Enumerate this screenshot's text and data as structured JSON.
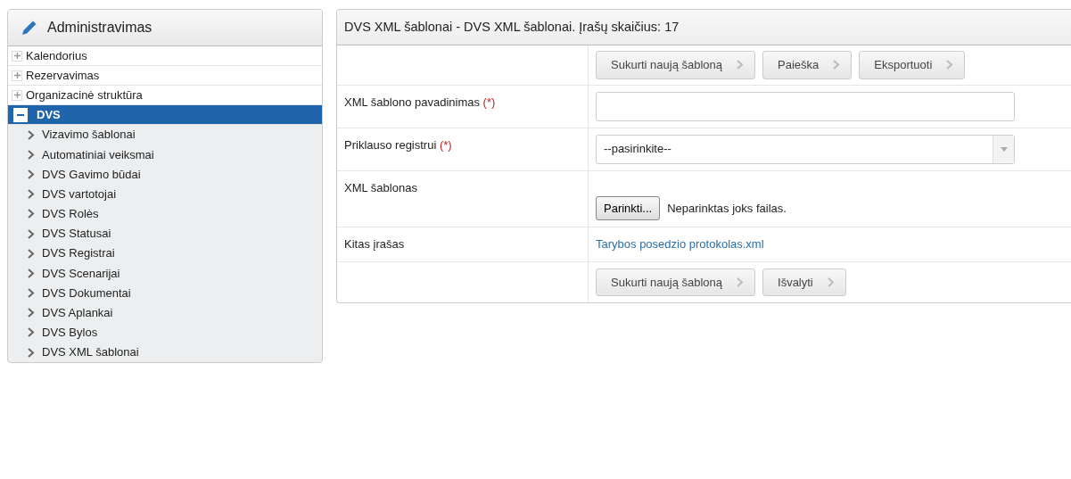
{
  "sidebar": {
    "title": "Administravimas",
    "items": [
      {
        "label": "Kalendorius",
        "expanded": false,
        "selected": false
      },
      {
        "label": "Rezervavimas",
        "expanded": false,
        "selected": false
      },
      {
        "label": "Organizacinė struktūra",
        "expanded": false,
        "selected": false
      },
      {
        "label": "DVS",
        "expanded": true,
        "selected": true,
        "children": [
          {
            "label": "Vizavimo šablonai"
          },
          {
            "label": "Automatiniai veiksmai"
          },
          {
            "label": "DVS Gavimo būdai"
          },
          {
            "label": "DVS vartotojai"
          },
          {
            "label": "DVS Rolės"
          },
          {
            "label": "DVS Statusai"
          },
          {
            "label": "DVS Registrai"
          },
          {
            "label": "DVS Scenarijai"
          },
          {
            "label": "DVS Dokumentai"
          },
          {
            "label": "DVS Aplankai"
          },
          {
            "label": "DVS Bylos"
          },
          {
            "label": "DVS XML šablonai"
          }
        ]
      }
    ]
  },
  "panel": {
    "title": "DVS XML šablonai - DVS XML šablonai. Įrašų skaičius: 17",
    "toolbar": [
      "Sukurti naują šabloną",
      "Paieška",
      "Eksportuoti"
    ],
    "rows": [
      {
        "kind": "text",
        "label": "XML šablono pavadinimas",
        "required": true,
        "required_mark": "(*)"
      },
      {
        "kind": "select",
        "label": "Priklauso registrui",
        "required": true,
        "required_mark": "(*)",
        "value": "--pasirinkite--"
      },
      {
        "kind": "file",
        "label": "XML šablonas",
        "button": "Parinkti...",
        "status": "Neparinktas joks failas."
      },
      {
        "kind": "link",
        "label": "Kitas įrašas",
        "link": "Tarybos posedzio protokolas.xml"
      },
      {
        "kind": "buttons",
        "buttons": [
          "Sukurti naują šabloną",
          "Išvalyti"
        ]
      }
    ]
  }
}
